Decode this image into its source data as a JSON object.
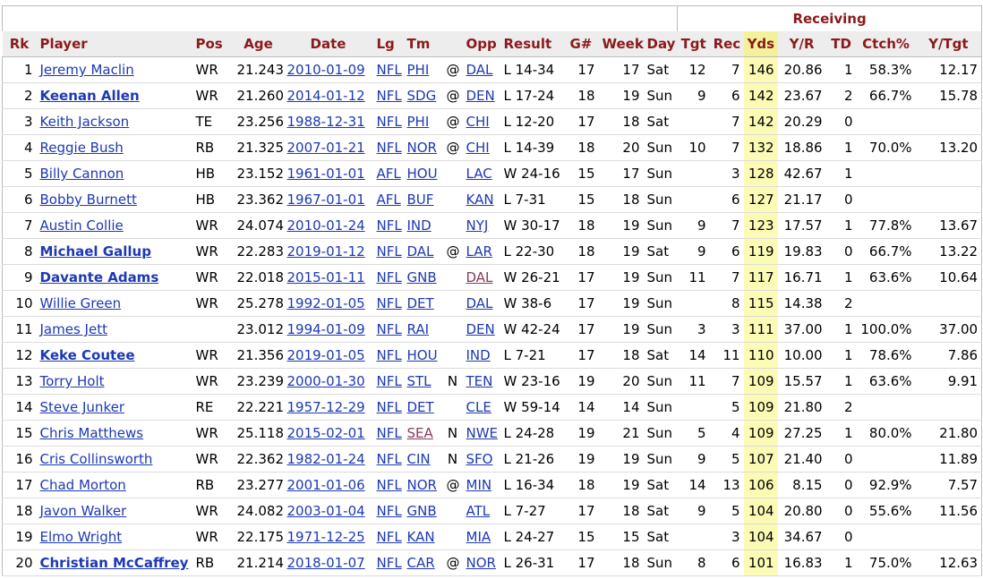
{
  "group_header": "Receiving",
  "columns": [
    "Rk",
    "Player",
    "Pos",
    "Age",
    "Date",
    "Lg",
    "Tm",
    "",
    "Opp",
    "Result",
    "G#",
    "Week",
    "Day",
    "Tgt",
    "Rec",
    "Yds",
    "Y/R",
    "TD",
    "Ctch%",
    "Y/Tgt"
  ],
  "rows": [
    {
      "rk": "1",
      "player": "Jeremy Maclin",
      "bold": false,
      "pos": "WR",
      "age": "21.243",
      "date": "2010-01-09",
      "lg": "NFL",
      "tm": "PHI",
      "tmv": false,
      "at": "@",
      "opp": "DAL",
      "oppv": false,
      "result": "L 14-34",
      "g": "17",
      "week": "17",
      "day": "Sat",
      "tgt": "12",
      "rec": "7",
      "yds": "146",
      "yr": "20.86",
      "td": "1",
      "ctch": "58.3%",
      "ytgt": "12.17"
    },
    {
      "rk": "2",
      "player": "Keenan Allen",
      "bold": true,
      "pos": "WR",
      "age": "21.260",
      "date": "2014-01-12",
      "lg": "NFL",
      "tm": "SDG",
      "tmv": false,
      "at": "@",
      "opp": "DEN",
      "oppv": false,
      "result": "L 17-24",
      "g": "18",
      "week": "19",
      "day": "Sun",
      "tgt": "9",
      "rec": "6",
      "yds": "142",
      "yr": "23.67",
      "td": "2",
      "ctch": "66.7%",
      "ytgt": "15.78"
    },
    {
      "rk": "3",
      "player": "Keith Jackson",
      "bold": false,
      "pos": "TE",
      "age": "23.256",
      "date": "1988-12-31",
      "lg": "NFL",
      "tm": "PHI",
      "tmv": false,
      "at": "@",
      "opp": "CHI",
      "oppv": false,
      "result": "L 12-20",
      "g": "17",
      "week": "18",
      "day": "Sat",
      "tgt": "",
      "rec": "7",
      "yds": "142",
      "yr": "20.29",
      "td": "0",
      "ctch": "",
      "ytgt": ""
    },
    {
      "rk": "4",
      "player": "Reggie Bush",
      "bold": false,
      "pos": "RB",
      "age": "21.325",
      "date": "2007-01-21",
      "lg": "NFL",
      "tm": "NOR",
      "tmv": false,
      "at": "@",
      "opp": "CHI",
      "oppv": false,
      "result": "L 14-39",
      "g": "18",
      "week": "20",
      "day": "Sun",
      "tgt": "10",
      "rec": "7",
      "yds": "132",
      "yr": "18.86",
      "td": "1",
      "ctch": "70.0%",
      "ytgt": "13.20"
    },
    {
      "rk": "5",
      "player": "Billy Cannon",
      "bold": false,
      "pos": "HB",
      "age": "23.152",
      "date": "1961-01-01",
      "lg": "AFL",
      "tm": "HOU",
      "tmv": false,
      "at": "",
      "opp": "LAC",
      "oppv": false,
      "result": "W 24-16",
      "g": "15",
      "week": "17",
      "day": "Sun",
      "tgt": "",
      "rec": "3",
      "yds": "128",
      "yr": "42.67",
      "td": "1",
      "ctch": "",
      "ytgt": ""
    },
    {
      "rk": "6",
      "player": "Bobby Burnett",
      "bold": false,
      "pos": "HB",
      "age": "23.362",
      "date": "1967-01-01",
      "lg": "AFL",
      "tm": "BUF",
      "tmv": false,
      "at": "",
      "opp": "KAN",
      "oppv": false,
      "result": "L 7-31",
      "g": "15",
      "week": "18",
      "day": "Sun",
      "tgt": "",
      "rec": "6",
      "yds": "127",
      "yr": "21.17",
      "td": "0",
      "ctch": "",
      "ytgt": ""
    },
    {
      "rk": "7",
      "player": "Austin Collie",
      "bold": false,
      "pos": "WR",
      "age": "24.074",
      "date": "2010-01-24",
      "lg": "NFL",
      "tm": "IND",
      "tmv": false,
      "at": "",
      "opp": "NYJ",
      "oppv": false,
      "result": "W 30-17",
      "g": "18",
      "week": "19",
      "day": "Sun",
      "tgt": "9",
      "rec": "7",
      "yds": "123",
      "yr": "17.57",
      "td": "1",
      "ctch": "77.8%",
      "ytgt": "13.67"
    },
    {
      "rk": "8",
      "player": "Michael Gallup",
      "bold": true,
      "pos": "WR",
      "age": "22.283",
      "date": "2019-01-12",
      "lg": "NFL",
      "tm": "DAL",
      "tmv": false,
      "at": "@",
      "opp": "LAR",
      "oppv": false,
      "result": "L 22-30",
      "g": "18",
      "week": "19",
      "day": "Sat",
      "tgt": "9",
      "rec": "6",
      "yds": "119",
      "yr": "19.83",
      "td": "0",
      "ctch": "66.7%",
      "ytgt": "13.22"
    },
    {
      "rk": "9",
      "player": "Davante Adams",
      "bold": true,
      "pos": "WR",
      "age": "22.018",
      "date": "2015-01-11",
      "lg": "NFL",
      "tm": "GNB",
      "tmv": false,
      "at": "",
      "opp": "DAL",
      "oppv": true,
      "result": "W 26-21",
      "g": "17",
      "week": "19",
      "day": "Sun",
      "tgt": "11",
      "rec": "7",
      "yds": "117",
      "yr": "16.71",
      "td": "1",
      "ctch": "63.6%",
      "ytgt": "10.64"
    },
    {
      "rk": "10",
      "player": "Willie Green",
      "bold": false,
      "pos": "WR",
      "age": "25.278",
      "date": "1992-01-05",
      "lg": "NFL",
      "tm": "DET",
      "tmv": false,
      "at": "",
      "opp": "DAL",
      "oppv": false,
      "result": "W 38-6",
      "g": "17",
      "week": "19",
      "day": "Sun",
      "tgt": "",
      "rec": "8",
      "yds": "115",
      "yr": "14.38",
      "td": "2",
      "ctch": "",
      "ytgt": ""
    },
    {
      "rk": "11",
      "player": "James Jett",
      "bold": false,
      "pos": "",
      "age": "23.012",
      "date": "1994-01-09",
      "lg": "NFL",
      "tm": "RAI",
      "tmv": false,
      "at": "",
      "opp": "DEN",
      "oppv": false,
      "result": "W 42-24",
      "g": "17",
      "week": "19",
      "day": "Sun",
      "tgt": "3",
      "rec": "3",
      "yds": "111",
      "yr": "37.00",
      "td": "1",
      "ctch": "100.0%",
      "ytgt": "37.00"
    },
    {
      "rk": "12",
      "player": "Keke Coutee",
      "bold": true,
      "pos": "WR",
      "age": "21.356",
      "date": "2019-01-05",
      "lg": "NFL",
      "tm": "HOU",
      "tmv": false,
      "at": "",
      "opp": "IND",
      "oppv": false,
      "result": "L 7-21",
      "g": "17",
      "week": "18",
      "day": "Sat",
      "tgt": "14",
      "rec": "11",
      "yds": "110",
      "yr": "10.00",
      "td": "1",
      "ctch": "78.6%",
      "ytgt": "7.86"
    },
    {
      "rk": "13",
      "player": "Torry Holt",
      "bold": false,
      "pos": "WR",
      "age": "23.239",
      "date": "2000-01-30",
      "lg": "NFL",
      "tm": "STL",
      "tmv": false,
      "at": "N",
      "opp": "TEN",
      "oppv": false,
      "result": "W 23-16",
      "g": "19",
      "week": "20",
      "day": "Sun",
      "tgt": "11",
      "rec": "7",
      "yds": "109",
      "yr": "15.57",
      "td": "1",
      "ctch": "63.6%",
      "ytgt": "9.91"
    },
    {
      "rk": "14",
      "player": "Steve Junker",
      "bold": false,
      "pos": "RE",
      "age": "22.221",
      "date": "1957-12-29",
      "lg": "NFL",
      "tm": "DET",
      "tmv": false,
      "at": "",
      "opp": "CLE",
      "oppv": false,
      "result": "W 59-14",
      "g": "14",
      "week": "14",
      "day": "Sun",
      "tgt": "",
      "rec": "5",
      "yds": "109",
      "yr": "21.80",
      "td": "2",
      "ctch": "",
      "ytgt": ""
    },
    {
      "rk": "15",
      "player": "Chris Matthews",
      "bold": false,
      "pos": "WR",
      "age": "25.118",
      "date": "2015-02-01",
      "lg": "NFL",
      "tm": "SEA",
      "tmv": true,
      "at": "N",
      "opp": "NWE",
      "oppv": false,
      "result": "L 24-28",
      "g": "19",
      "week": "21",
      "day": "Sun",
      "tgt": "5",
      "rec": "4",
      "yds": "109",
      "yr": "27.25",
      "td": "1",
      "ctch": "80.0%",
      "ytgt": "21.80"
    },
    {
      "rk": "16",
      "player": "Cris Collinsworth",
      "bold": false,
      "pos": "WR",
      "age": "22.362",
      "date": "1982-01-24",
      "lg": "NFL",
      "tm": "CIN",
      "tmv": false,
      "at": "N",
      "opp": "SFO",
      "oppv": false,
      "result": "L 21-26",
      "g": "19",
      "week": "19",
      "day": "Sun",
      "tgt": "9",
      "rec": "5",
      "yds": "107",
      "yr": "21.40",
      "td": "0",
      "ctch": "",
      "ytgt": "11.89"
    },
    {
      "rk": "17",
      "player": "Chad Morton",
      "bold": false,
      "pos": "RB",
      "age": "23.277",
      "date": "2001-01-06",
      "lg": "NFL",
      "tm": "NOR",
      "tmv": false,
      "at": "@",
      "opp": "MIN",
      "oppv": false,
      "result": "L 16-34",
      "g": "18",
      "week": "19",
      "day": "Sat",
      "tgt": "14",
      "rec": "13",
      "yds": "106",
      "yr": "8.15",
      "td": "0",
      "ctch": "92.9%",
      "ytgt": "7.57"
    },
    {
      "rk": "18",
      "player": "Javon Walker",
      "bold": false,
      "pos": "WR",
      "age": "24.082",
      "date": "2003-01-04",
      "lg": "NFL",
      "tm": "GNB",
      "tmv": false,
      "at": "",
      "opp": "ATL",
      "oppv": false,
      "result": "L 7-27",
      "g": "17",
      "week": "18",
      "day": "Sat",
      "tgt": "9",
      "rec": "5",
      "yds": "104",
      "yr": "20.80",
      "td": "0",
      "ctch": "55.6%",
      "ytgt": "11.56"
    },
    {
      "rk": "19",
      "player": "Elmo Wright",
      "bold": false,
      "pos": "WR",
      "age": "22.175",
      "date": "1971-12-25",
      "lg": "NFL",
      "tm": "KAN",
      "tmv": false,
      "at": "",
      "opp": "MIA",
      "oppv": false,
      "result": "L 24-27",
      "g": "15",
      "week": "15",
      "day": "Sat",
      "tgt": "",
      "rec": "3",
      "yds": "104",
      "yr": "34.67",
      "td": "0",
      "ctch": "",
      "ytgt": ""
    },
    {
      "rk": "20",
      "player": "Christian McCaffrey",
      "bold": true,
      "pos": "RB",
      "age": "21.214",
      "date": "2018-01-07",
      "lg": "NFL",
      "tm": "CAR",
      "tmv": false,
      "at": "@",
      "opp": "NOR",
      "oppv": false,
      "result": "L 26-31",
      "g": "17",
      "week": "18",
      "day": "Sun",
      "tgt": "8",
      "rec": "6",
      "yds": "101",
      "yr": "16.83",
      "td": "1",
      "ctch": "75.0%",
      "ytgt": "12.63"
    }
  ],
  "colors": {
    "header_text": "#8b1a1a",
    "link": "#1d39b3",
    "visited_link": "#8a3a5c",
    "yds_highlight": "#fbfbb6"
  }
}
